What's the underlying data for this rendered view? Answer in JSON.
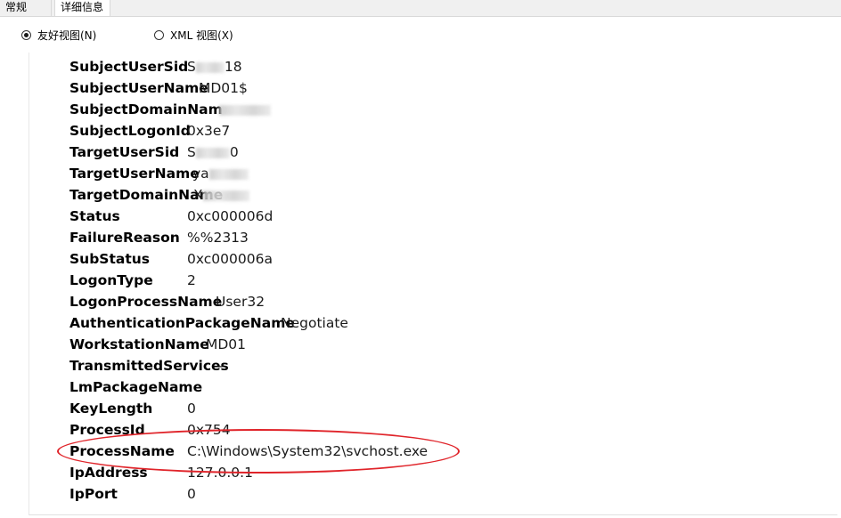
{
  "tabs": [
    {
      "label": "常规",
      "active": false
    },
    {
      "label": "详细信息",
      "active": true
    }
  ],
  "view_options": {
    "friendly": {
      "label": "友好视图(N)",
      "selected": true
    },
    "xml": {
      "label": "XML 视图(X)",
      "selected": false
    }
  },
  "fields": [
    {
      "key": "SubjectUserSid",
      "value": "S",
      "value_tail": "18",
      "redacted": true
    },
    {
      "key": "SubjectUserName",
      "value": "MD01$"
    },
    {
      "key": "SubjectDomainNam",
      "value": "",
      "redacted": true
    },
    {
      "key": "SubjectLogonId",
      "value": "0x3e7"
    },
    {
      "key": "TargetUserSid",
      "value": "S",
      "value_tail": "0",
      "redacted": true
    },
    {
      "key": "TargetUserName",
      "value": "ya",
      "redacted": true
    },
    {
      "key": "TargetDomainName",
      "value": "X",
      "redacted": true
    },
    {
      "key": "Status",
      "value": "0xc000006d"
    },
    {
      "key": "FailureReason",
      "value": "%%2313"
    },
    {
      "key": "SubStatus",
      "value": "0xc000006a"
    },
    {
      "key": "LogonType",
      "value": "2"
    },
    {
      "key": "LogonProcessName",
      "value": "User32"
    },
    {
      "key": "AuthenticationPackageName",
      "value": "Negotiate"
    },
    {
      "key": "WorkstationName",
      "value": "MD01"
    },
    {
      "key": "TransmittedServices",
      "value": "-"
    },
    {
      "key": "LmPackageName",
      "value": "-"
    },
    {
      "key": "KeyLength",
      "value": "0"
    },
    {
      "key": "ProcessId",
      "value": "0x754"
    },
    {
      "key": "ProcessName",
      "value": "C:\\Windows\\System32\\svchost.exe",
      "highlighted": true
    },
    {
      "key": "IpAddress",
      "value": "127.0.0.1"
    },
    {
      "key": "IpPort",
      "value": "0"
    }
  ],
  "colors": {
    "annotation": "#e0242a",
    "panel_bg": "#ffffff",
    "window_bg": "#f0f0f0"
  }
}
